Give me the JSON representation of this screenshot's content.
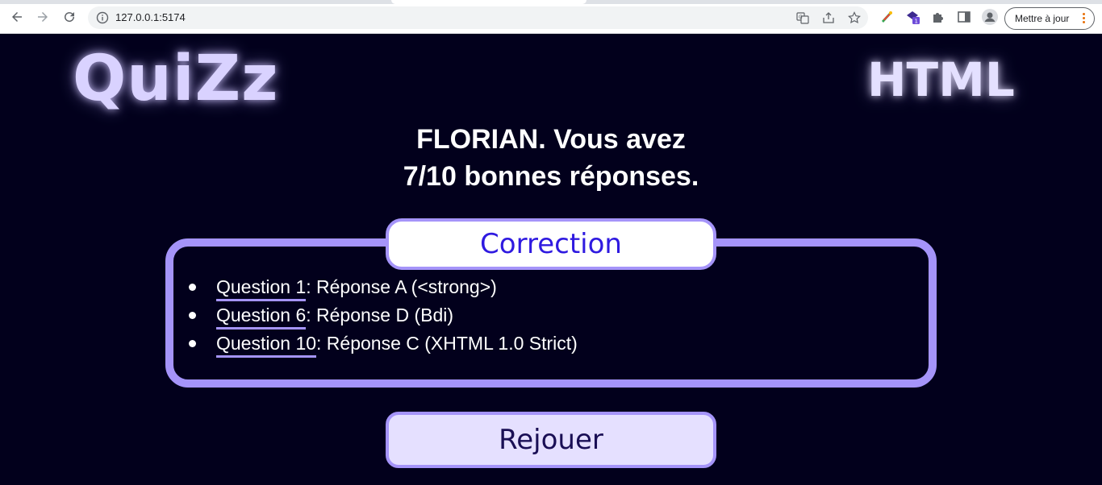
{
  "browser": {
    "url": "127.0.0.1:5174",
    "update_label": "Mettre à jour",
    "icons": [
      "back-icon",
      "forward-icon",
      "reload-icon",
      "info-icon",
      "translate-icon",
      "share-icon",
      "bookmark-star-icon",
      "extension-color-icon",
      "extension-badge-icon",
      "puzzle-icon",
      "side-panel-icon",
      "profile-icon",
      "menu-dots-icon"
    ],
    "extension_badge": "1"
  },
  "header": {
    "logo_left": "QuiZz",
    "logo_right": "HTML"
  },
  "result": {
    "line1": "FLORIAN. Vous avez",
    "line2": "7/10 bonnes réponses."
  },
  "correction": {
    "title": "Correction",
    "items": [
      {
        "question": "Question 1",
        "answer": ": Réponse A (<strong>)"
      },
      {
        "question": "Question 6",
        "answer": ": Réponse D (Bdi)"
      },
      {
        "question": "Question 10",
        "answer": ": Réponse C (XHTML 1.0 Strict)"
      }
    ]
  },
  "replay": {
    "label": "Rejouer"
  },
  "colors": {
    "background": "#02001c",
    "accent": "#a594f9",
    "title_text": "#2f1ae0",
    "button_bg": "#e5e0ff"
  }
}
